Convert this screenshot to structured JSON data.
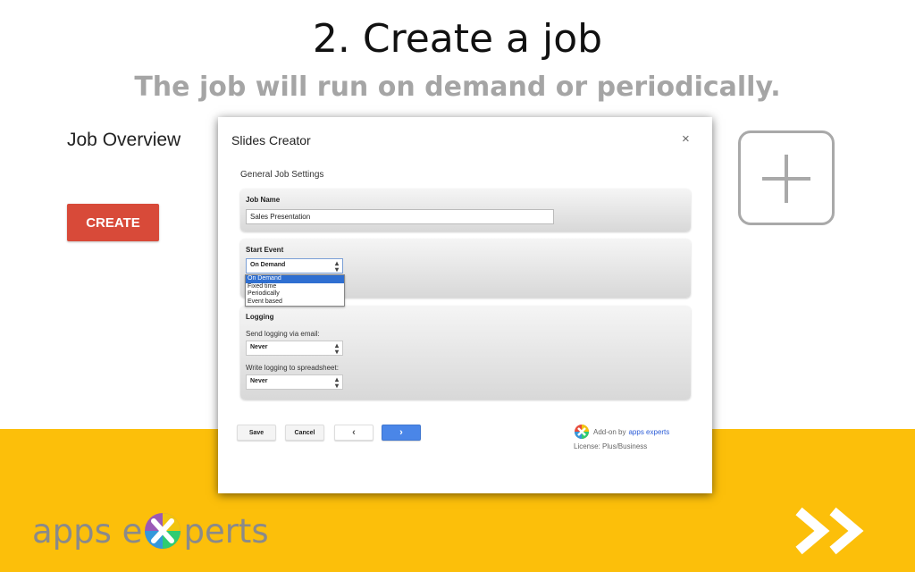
{
  "slide": {
    "title": "2. Create a job",
    "subtitle": "The job will run on demand or periodically."
  },
  "left_panel": {
    "heading": "Job Overview",
    "create_button": "CREATE"
  },
  "dialog": {
    "title": "Slides Creator",
    "close": "×",
    "section_title": "General Job Settings",
    "job_name": {
      "label": "Job Name",
      "value": "Sales Presentation"
    },
    "start_event": {
      "label": "Start Event",
      "selected": "On Demand",
      "options": [
        "On Demand",
        "Fixed time",
        "Periodically",
        "Event based"
      ]
    },
    "logging": {
      "label": "Logging",
      "email_label": "Send logging via email:",
      "email_value": "Never",
      "sheet_label": "Write logging to spreadsheet:",
      "sheet_value": "Never"
    },
    "buttons": {
      "save": "Save",
      "cancel": "Cancel",
      "prev": "‹",
      "next": "›"
    },
    "addon": {
      "prefix": "Add-on by",
      "link": "apps experts",
      "license": "License: Plus/Business"
    }
  },
  "footer": {
    "logo_part1": "apps e",
    "logo_part2": "perts"
  },
  "colors": {
    "accent_yellow": "#fcbf0a",
    "create_red": "#d84a39",
    "next_blue": "#4a86e8",
    "selected_blue": "#2f6fd1"
  },
  "icons": [
    "plus-icon",
    "close-icon",
    "select-arrows-icon",
    "chevron-left-icon",
    "chevron-right-icon",
    "addon-logo-icon",
    "double-chevron-right-icon"
  ]
}
